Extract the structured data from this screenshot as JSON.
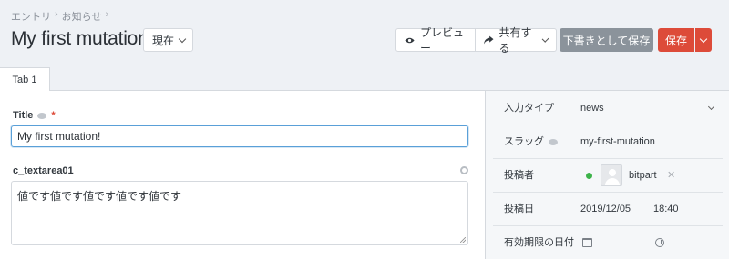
{
  "breadcrumb": {
    "items": [
      "エントリ",
      "お知らせ"
    ],
    "sep": "›"
  },
  "header": {
    "title": "My first mutation!",
    "status_label": "現在",
    "preview_label": "プレビュー",
    "share_label": "共有する",
    "draft_label": "下書きとして保存",
    "save_label": "保存"
  },
  "tabs": [
    {
      "label": "Tab 1"
    }
  ],
  "form": {
    "title_label": "Title",
    "required_mark": "*",
    "title_value": "My first mutation!",
    "textarea_label": "c_textarea01",
    "textarea_value": "値です値です値です値です値です"
  },
  "sidebar": {
    "input_type": {
      "label": "入力タイプ",
      "value": "news"
    },
    "slug": {
      "label": "スラッグ",
      "value": "my-first-mutation"
    },
    "author": {
      "label": "投稿者",
      "value": "bitpart",
      "remove": "✕"
    },
    "post_date": {
      "label": "投稿日",
      "date": "2019/12/05",
      "time": "18:40"
    },
    "expiry": {
      "label": "有効期限の日付"
    }
  },
  "colors": {
    "accent": "#dd4b39",
    "draft": "#8b939b",
    "focus": "#5aa0d8",
    "status_online": "#3cb34a"
  }
}
